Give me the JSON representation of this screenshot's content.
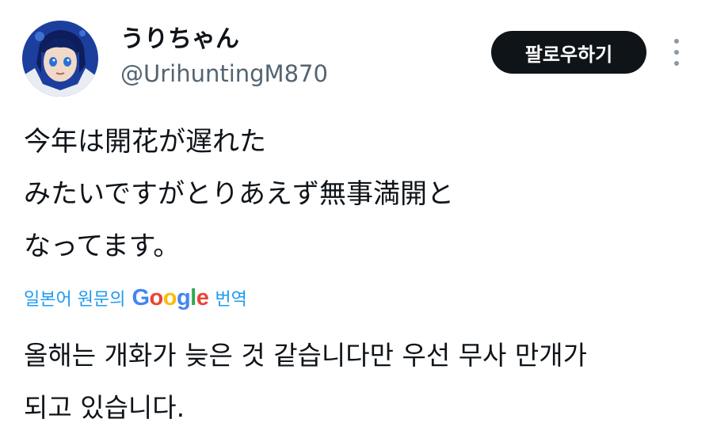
{
  "user": {
    "display_name": "うりちゃん",
    "handle": "@UrihuntingM870",
    "avatar_icon": "avatar-anime-character-icon"
  },
  "header": {
    "follow_label": "팔로우하기",
    "more_icon": "more-vertical-icon"
  },
  "tweet": {
    "lines": [
      "今年は開花が遅れた",
      "みたいですがとりあえず無事満開と",
      "なってます。"
    ]
  },
  "translation": {
    "prefix": "일본어 원문의",
    "google_letters": [
      "G",
      "o",
      "o",
      "g",
      "l",
      "e"
    ],
    "suffix": "번역",
    "lines": [
      "올해는 개화가 늦은 것 같습니다만 우선 무사 만개가",
      "되고 있습니다."
    ]
  },
  "colors": {
    "text": "#0f1419",
    "secondary_text": "#536471",
    "link": "#1d9bf0",
    "button_bg": "#0f1419",
    "google_blue": "#4285F4",
    "google_red": "#EA4335",
    "google_yellow": "#FBBC05",
    "google_green": "#34A853"
  }
}
